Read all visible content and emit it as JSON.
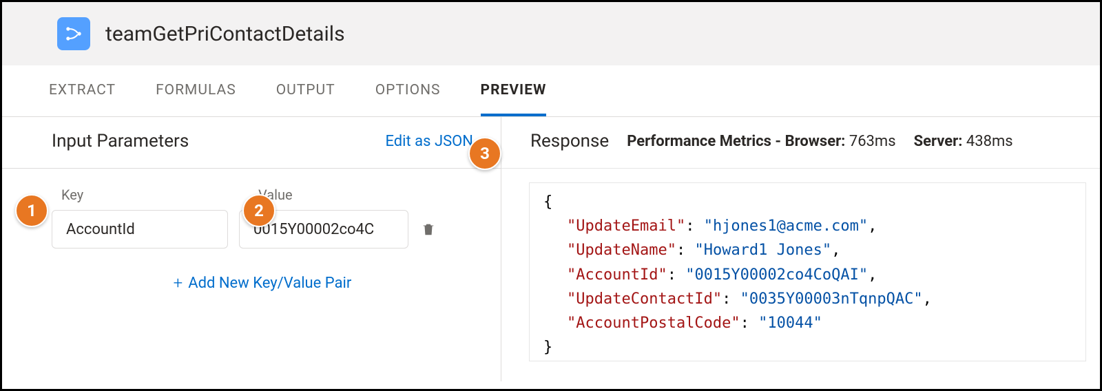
{
  "header": {
    "title": "teamGetPriContactDetails",
    "icon": "data-mapper-icon"
  },
  "tabs": {
    "items": [
      "EXTRACT",
      "FORMULAS",
      "OUTPUT",
      "OPTIONS",
      "PREVIEW"
    ],
    "active_index": 4
  },
  "left": {
    "title": "Input Parameters",
    "edit_link": "Edit as JSON",
    "key_label": "Key",
    "value_label": "Value",
    "params": [
      {
        "key": "AccountId",
        "value": "0015Y00002co4C"
      }
    ],
    "add_label": "Add New Key/Value Pair"
  },
  "right": {
    "title": "Response",
    "metrics_label": "Performance Metrics - ",
    "browser_label": "Browser:",
    "browser_value": "763ms",
    "server_label": "Server:",
    "server_value": "438ms",
    "response": {
      "UpdateEmail": "hjones1@acme.com",
      "UpdateName": "Howard1 Jones",
      "AccountId": "0015Y00002co4CoQAI",
      "UpdateContactId": "0035Y00003nTqnpQAC",
      "AccountPostalCode": "10044"
    }
  },
  "callouts": [
    "1",
    "2",
    "3"
  ]
}
